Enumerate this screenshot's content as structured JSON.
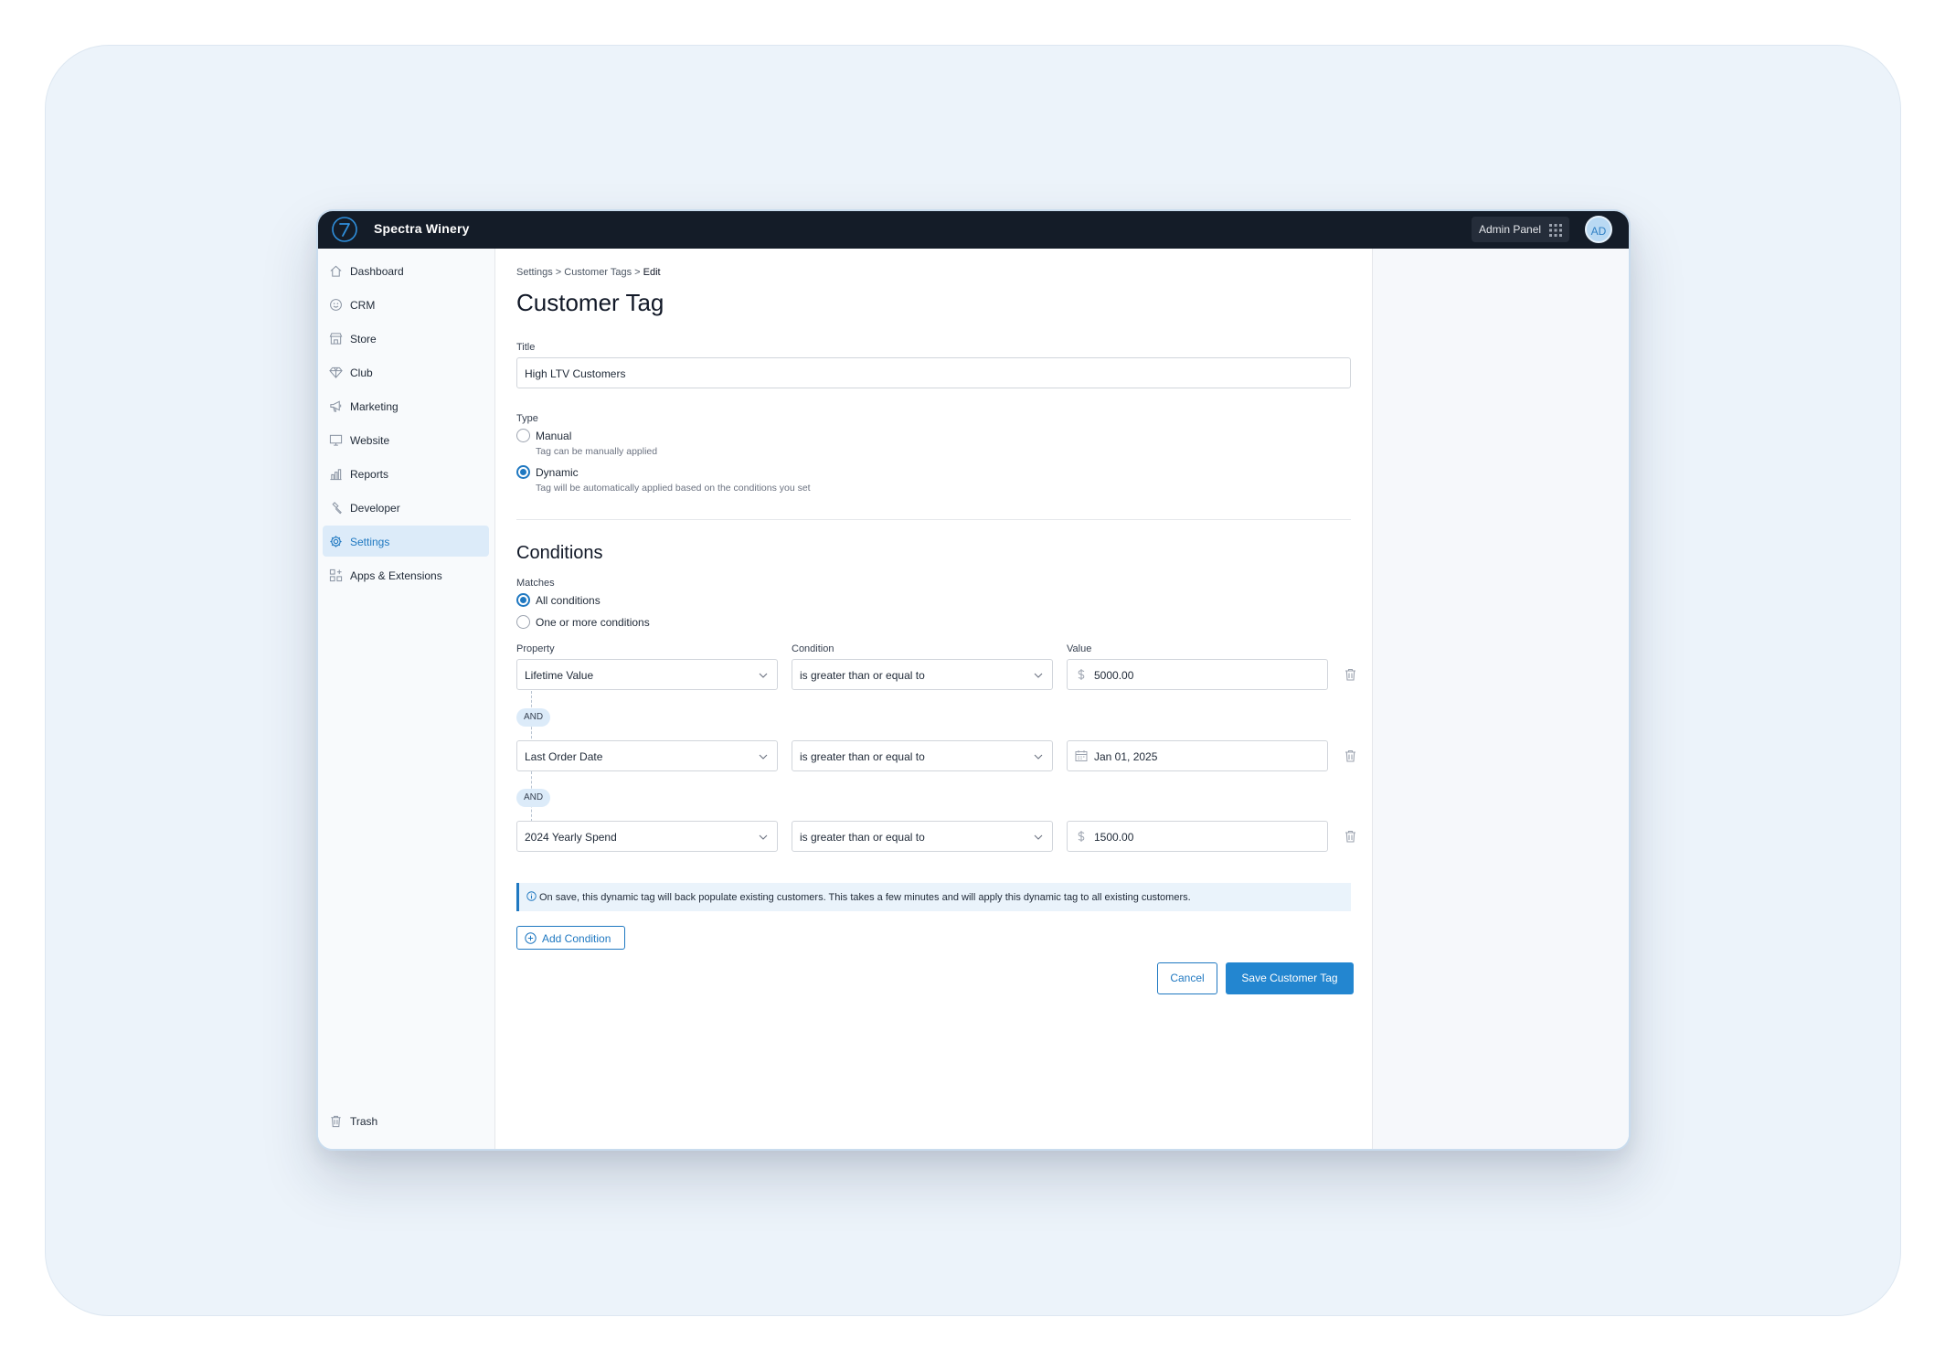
{
  "app": {
    "brand": "Spectra Winery",
    "admin_panel": "Admin Panel",
    "avatar": "AD"
  },
  "sidebar": {
    "items": [
      {
        "label": "Dashboard",
        "icon": "home-icon"
      },
      {
        "label": "CRM",
        "icon": "smiley-icon"
      },
      {
        "label": "Store",
        "icon": "store-icon"
      },
      {
        "label": "Club",
        "icon": "diamond-icon"
      },
      {
        "label": "Marketing",
        "icon": "megaphone-icon"
      },
      {
        "label": "Website",
        "icon": "monitor-icon"
      },
      {
        "label": "Reports",
        "icon": "bar-chart-icon"
      },
      {
        "label": "Developer",
        "icon": "hammer-icon"
      },
      {
        "label": "Settings",
        "icon": "gear-icon",
        "active": true
      },
      {
        "label": "Apps & Extensions",
        "icon": "apps-icon"
      }
    ],
    "trash": "Trash"
  },
  "breadcrumb": {
    "settings": "Settings >",
    "customer_tags": "Customer Tags >",
    "current": "Edit"
  },
  "page": {
    "title": "Customer Tag"
  },
  "form": {
    "title_label": "Title",
    "title_value": "High LTV Customers",
    "type_label": "Type",
    "type_options": [
      {
        "label": "Manual",
        "help": "Tag can be manually applied",
        "selected": false
      },
      {
        "label": "Dynamic",
        "help": "Tag will be automatically applied based on the conditions you set",
        "selected": true
      }
    ]
  },
  "conditions": {
    "heading": "Conditions",
    "matches_label": "Matches",
    "matches_options": [
      {
        "label": "All conditions",
        "selected": true
      },
      {
        "label": "One or more conditions",
        "selected": false
      }
    ],
    "col_property": "Property",
    "col_condition": "Condition",
    "col_value": "Value",
    "rows": [
      {
        "property": "Lifetime Value",
        "condition": "is greater than or equal to",
        "value": "5000.00",
        "value_icon": "dollar-icon"
      },
      {
        "property": "Last Order Date",
        "condition": "is greater than or equal to",
        "value": "Jan 01, 2025",
        "value_icon": "calendar-icon"
      },
      {
        "property": "2024 Yearly Spend",
        "condition": "is greater than or equal to",
        "value": "1500.00",
        "value_icon": "dollar-icon"
      }
    ],
    "and_label": "AND",
    "notice": "On save, this dynamic tag will back populate existing customers. This takes a few minutes and will apply this dynamic tag to all existing customers.",
    "add_condition": "Add Condition"
  },
  "actions": {
    "cancel": "Cancel",
    "save": "Save Customer Tag"
  },
  "colors": {
    "accent": "#2386d0",
    "topbar": "#141c28",
    "active_nav_bg": "#dcebf9"
  }
}
